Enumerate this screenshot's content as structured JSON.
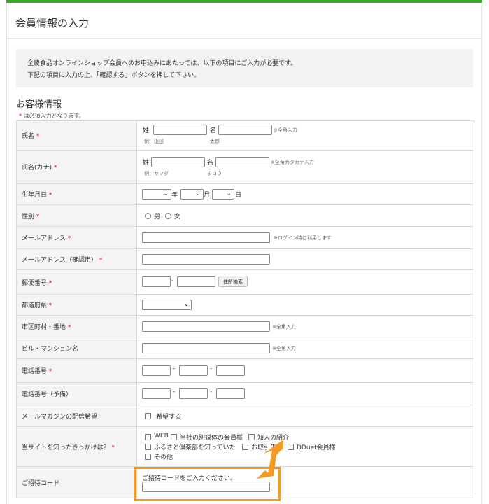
{
  "page": {
    "title": "会員情報の入力"
  },
  "notice": {
    "line1": "全農食品オンラインショップ会員へのお申込みにあたっては、以下の項目にご入力が必要です。",
    "line2": "下記の項目に入力の上、「確認する」ボタンを押して下さい。"
  },
  "section": {
    "title": "お客様情報",
    "required_star": "*",
    "required_note": " は必須入力となります。"
  },
  "form": {
    "name": {
      "label": "氏名",
      "sei_label": "姓",
      "mei_label": "名",
      "note": "※全角入力",
      "example_sei": "例：山田",
      "example_mei": "太郎"
    },
    "name_kana": {
      "label": "氏名(カナ)",
      "sei_label": "姓",
      "mei_label": "名",
      "note": "※全角カタカナ入力",
      "example_sei": "例：ヤマダ",
      "example_mei": "タロウ"
    },
    "birthday": {
      "label": "生年月日",
      "year_suffix": "年",
      "month_suffix": "月",
      "day_suffix": "日",
      "year_value": "",
      "month_value": "",
      "day_value": ""
    },
    "gender": {
      "label": "性別",
      "options": [
        "男",
        "女"
      ]
    },
    "email": {
      "label": "メールアドレス",
      "value": "",
      "note": "※ログイン時に利用します"
    },
    "email_confirm": {
      "label": "メールアドレス（確認用）",
      "value": ""
    },
    "postal": {
      "label": "郵便番号",
      "separator": "-",
      "search_button": "住所検索"
    },
    "prefecture": {
      "label": "都道府県",
      "value": ""
    },
    "city": {
      "label": "市区町村・番地",
      "note": "※全角入力"
    },
    "building": {
      "label": "ビル・マンション名",
      "note": "※全角入力"
    },
    "phone": {
      "label": "電話番号",
      "separator": "-"
    },
    "phone_sub": {
      "label": "電話番号（予備）",
      "separator": "-"
    },
    "newsletter": {
      "label": "メールマガジンの配信希望",
      "option": "希望する"
    },
    "referral_source": {
      "label": "当サイトを知ったきっかけは？",
      "options": [
        "WEB",
        "当社の別媒体の会員様",
        "知人の紹介",
        "ふるさと倶楽部を知っていた",
        "お取引先様",
        "DDuet会員様",
        "その他"
      ]
    },
    "invite_code": {
      "label": "ご招待コード",
      "prompt": "ご招待コードをご入力ください。",
      "value": ""
    }
  },
  "colors": {
    "accent_green": "#3aa829",
    "required_red": "#d6001c",
    "highlight_orange": "#f39a25"
  }
}
